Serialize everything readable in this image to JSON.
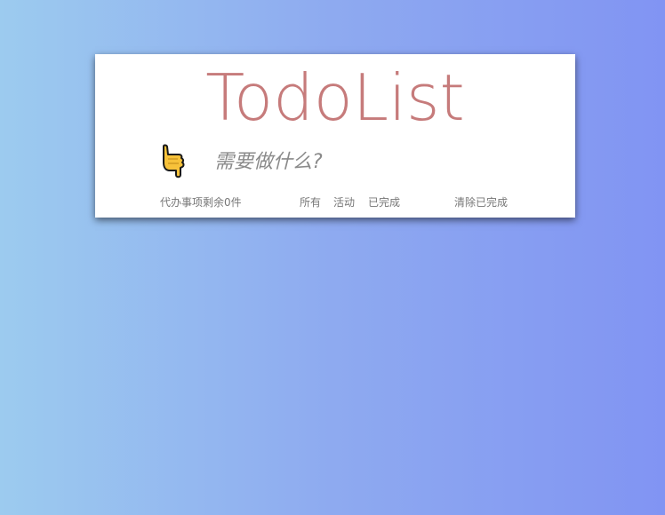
{
  "app": {
    "title": "TodoList"
  },
  "input": {
    "placeholder": "需要做什么?",
    "value": ""
  },
  "footer": {
    "count_text": "代办事项剩余0件",
    "filters": [
      {
        "label": "所有"
      },
      {
        "label": "活动"
      },
      {
        "label": "已完成"
      }
    ],
    "clear_label": "清除已完成"
  },
  "icons": {
    "pointer": "hand-pointing-down-icon"
  },
  "colors": {
    "title": "#c67b7b",
    "background_start": "#9ccbef",
    "background_end": "#8194f3",
    "hand_fill": "#f7c23a"
  }
}
